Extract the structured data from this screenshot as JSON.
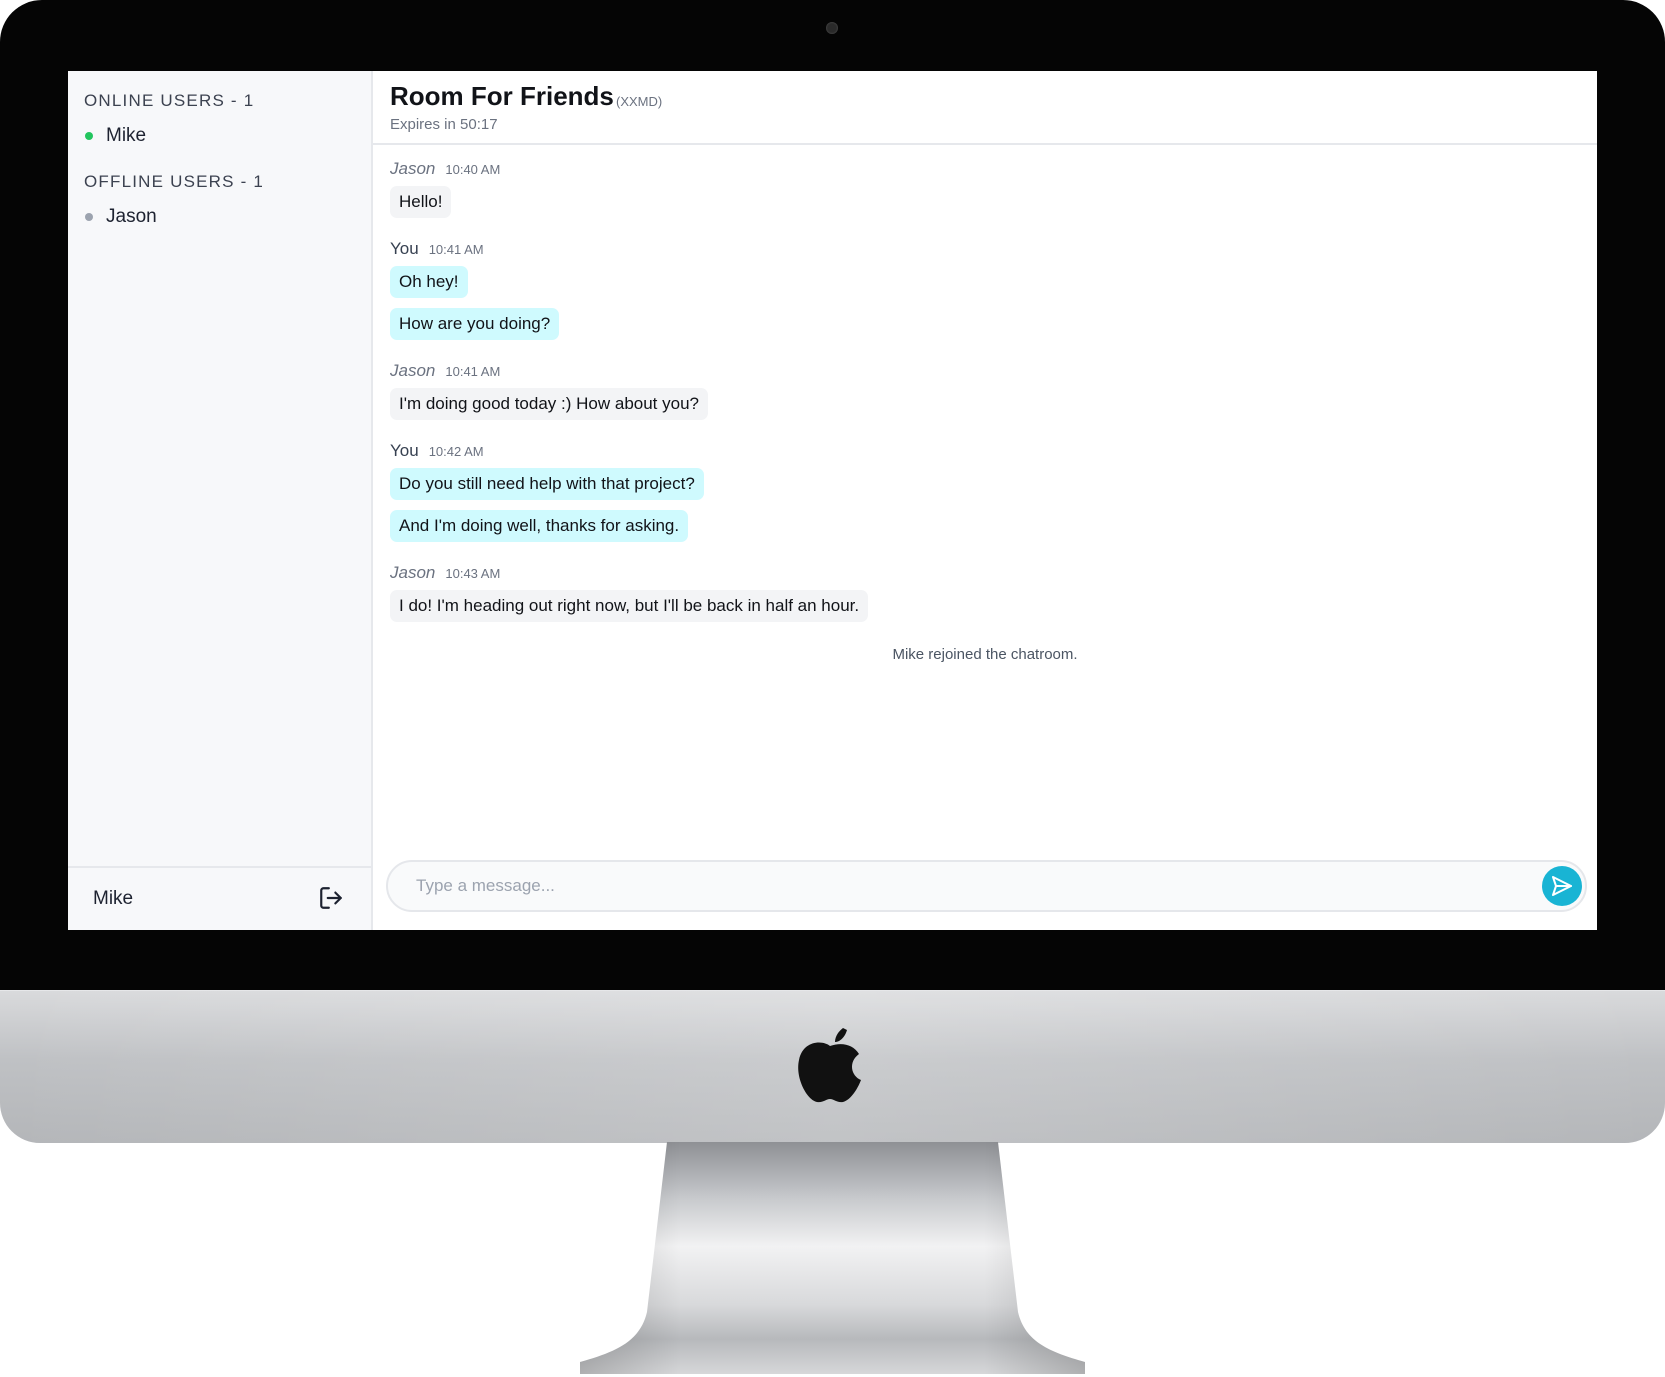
{
  "sidebar": {
    "online_title": "ONLINE USERS - 1",
    "online_users": [
      {
        "name": "Mike",
        "status_color": "#22c55e"
      }
    ],
    "offline_title": "OFFLINE USERS - 1",
    "offline_users": [
      {
        "name": "Jason",
        "status_color": "#9ca3af"
      }
    ],
    "current_user": "Mike",
    "logout_icon": "logout-icon"
  },
  "room": {
    "title": "Room For Friends",
    "code": "(XXMD)",
    "expires": "Expires in 50:17"
  },
  "messages": [
    {
      "author": "Jason",
      "time": "10:40 AM",
      "lines": [
        "Hello!"
      ]
    },
    {
      "author": "You",
      "time": "10:41 AM",
      "lines": [
        "Oh hey!",
        "How are you doing?"
      ]
    },
    {
      "author": "Jason",
      "time": "10:41 AM",
      "lines": [
        "I'm doing good today :) How about you?"
      ]
    },
    {
      "author": "You",
      "time": "10:42 AM",
      "lines": [
        "Do you still need help with that project?",
        "And I'm doing well, thanks for asking."
      ]
    },
    {
      "author": "Jason",
      "time": "10:43 AM",
      "lines": [
        "I do! I'm heading out right now, but I'll be back in half an hour."
      ]
    }
  ],
  "system_message": "Mike rejoined the chatroom.",
  "composer": {
    "placeholder": "Type a message...",
    "send_icon": "send-icon"
  },
  "colors": {
    "accent": "#19b4d4",
    "own_bubble": "#cffafe",
    "other_bubble": "#f3f4f6"
  }
}
